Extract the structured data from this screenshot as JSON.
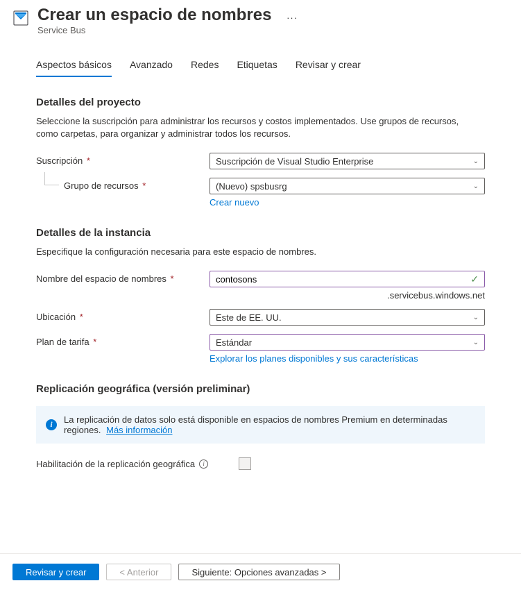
{
  "header": {
    "title": "Crear un espacio de nombres",
    "subtitle": "Service Bus"
  },
  "tabs": [
    "Aspectos básicos",
    "Avanzado",
    "Redes",
    "Etiquetas",
    "Revisar y crear"
  ],
  "activeTab": 0,
  "projectDetails": {
    "title": "Detalles del proyecto",
    "description": "Seleccione la suscripción para administrar los recursos y costos implementados. Use grupos de recursos, como carpetas, para organizar y administrar todos los recursos."
  },
  "fields": {
    "subscription": {
      "label": "Suscripción",
      "value": "Suscripción de Visual Studio Enterprise"
    },
    "resourceGroup": {
      "label": "Grupo de recursos",
      "value": "(Nuevo) spsbusrg",
      "createNew": "Crear nuevo"
    }
  },
  "instanceDetails": {
    "title": "Detalles de la instancia",
    "description": "Especifique la configuración necesaria para este espacio de nombres."
  },
  "instance": {
    "namespaceName": {
      "label": "Nombre del espacio de nombres",
      "value": "contosons",
      "suffix": ".servicebus.windows.net"
    },
    "location": {
      "label": "Ubicación",
      "value": "Este de EE. UU."
    },
    "pricingTier": {
      "label": "Plan de tarifa",
      "value": "Estándar",
      "explore": "Explorar los planes disponibles y sus características"
    }
  },
  "geoRep": {
    "title": "Replicación geográfica (versión preliminar)",
    "bannerText": "La replicación de datos solo está disponible en espacios de nombres Premium en determinadas regiones.",
    "bannerLink": "Más información",
    "enableLabel": "Habilitación de la replicación geográfica"
  },
  "footer": {
    "review": "Revisar y crear",
    "previous": "< Anterior",
    "next": "Siguiente: Opciones avanzadas >"
  }
}
